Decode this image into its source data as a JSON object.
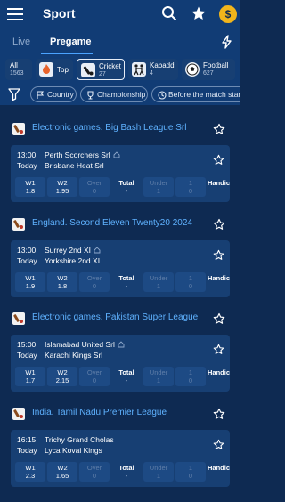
{
  "header": {
    "title": "Sport",
    "coin_symbol": "$"
  },
  "tabs": [
    {
      "label": "Live"
    },
    {
      "label": "Pregame"
    }
  ],
  "sports": [
    {
      "name": "All",
      "count": "1563",
      "icon": "all-icon"
    },
    {
      "name": "Top",
      "count": "",
      "icon": "fire-icon"
    },
    {
      "name": "Cricket",
      "count": "27",
      "icon": "cricket-icon"
    },
    {
      "name": "Kabaddi",
      "count": "4",
      "icon": "kabaddi-icon"
    },
    {
      "name": "Football",
      "count": "627",
      "icon": "football-icon"
    }
  ],
  "filters": [
    {
      "label": "Country",
      "icon": "flag-icon"
    },
    {
      "label": "Championship",
      "icon": "trophy-icon"
    },
    {
      "label": "Before the match starts",
      "icon": "clock-icon"
    }
  ],
  "odds_labels": {
    "w1": "W1",
    "w2": "W2",
    "over": "Over",
    "total": "Total",
    "under": "Under",
    "handicap": "Handicap"
  },
  "leagues": [
    {
      "name": "Electronic games. Big Bash League Srl",
      "match": {
        "time": "13:00",
        "day": "Today",
        "team1": "Perth Scorchers Srl",
        "team2": "Brisbane Heat Srl",
        "w1": "1.8",
        "w2": "1.95",
        "over": "0",
        "total": "-",
        "under": "1",
        "handicap": "0"
      }
    },
    {
      "name": "England. Second Eleven Twenty20 2024",
      "match": {
        "time": "13:00",
        "day": "Today",
        "team1": "Surrey 2nd XI",
        "team2": "Yorkshire 2nd XI",
        "w1": "1.9",
        "w2": "1.8",
        "over": "0",
        "total": "-",
        "under": "1",
        "handicap": "0"
      }
    },
    {
      "name": "Electronic games. Pakistan Super League Srl",
      "match": {
        "time": "15:00",
        "day": "Today",
        "team1": "Islamabad United Srl",
        "team2": "Karachi Kings Srl",
        "w1": "1.7",
        "w2": "2.15",
        "over": "0",
        "total": "-",
        "under": "1",
        "handicap": "0"
      }
    },
    {
      "name": "India. Tamil Nadu Premier League",
      "match": {
        "time": "16:15",
        "day": "Today",
        "team1": "Trichy Grand Cholas",
        "team2": "Lyca Kovai Kings",
        "w1": "2.3",
        "w2": "1.65",
        "over": "0",
        "total": "-",
        "under": "1",
        "handicap": "0"
      }
    }
  ],
  "colors": {
    "background": "#0e2a52",
    "panel": "#173f73",
    "accent": "#5fb2ff",
    "coin": "#f1b51c"
  }
}
